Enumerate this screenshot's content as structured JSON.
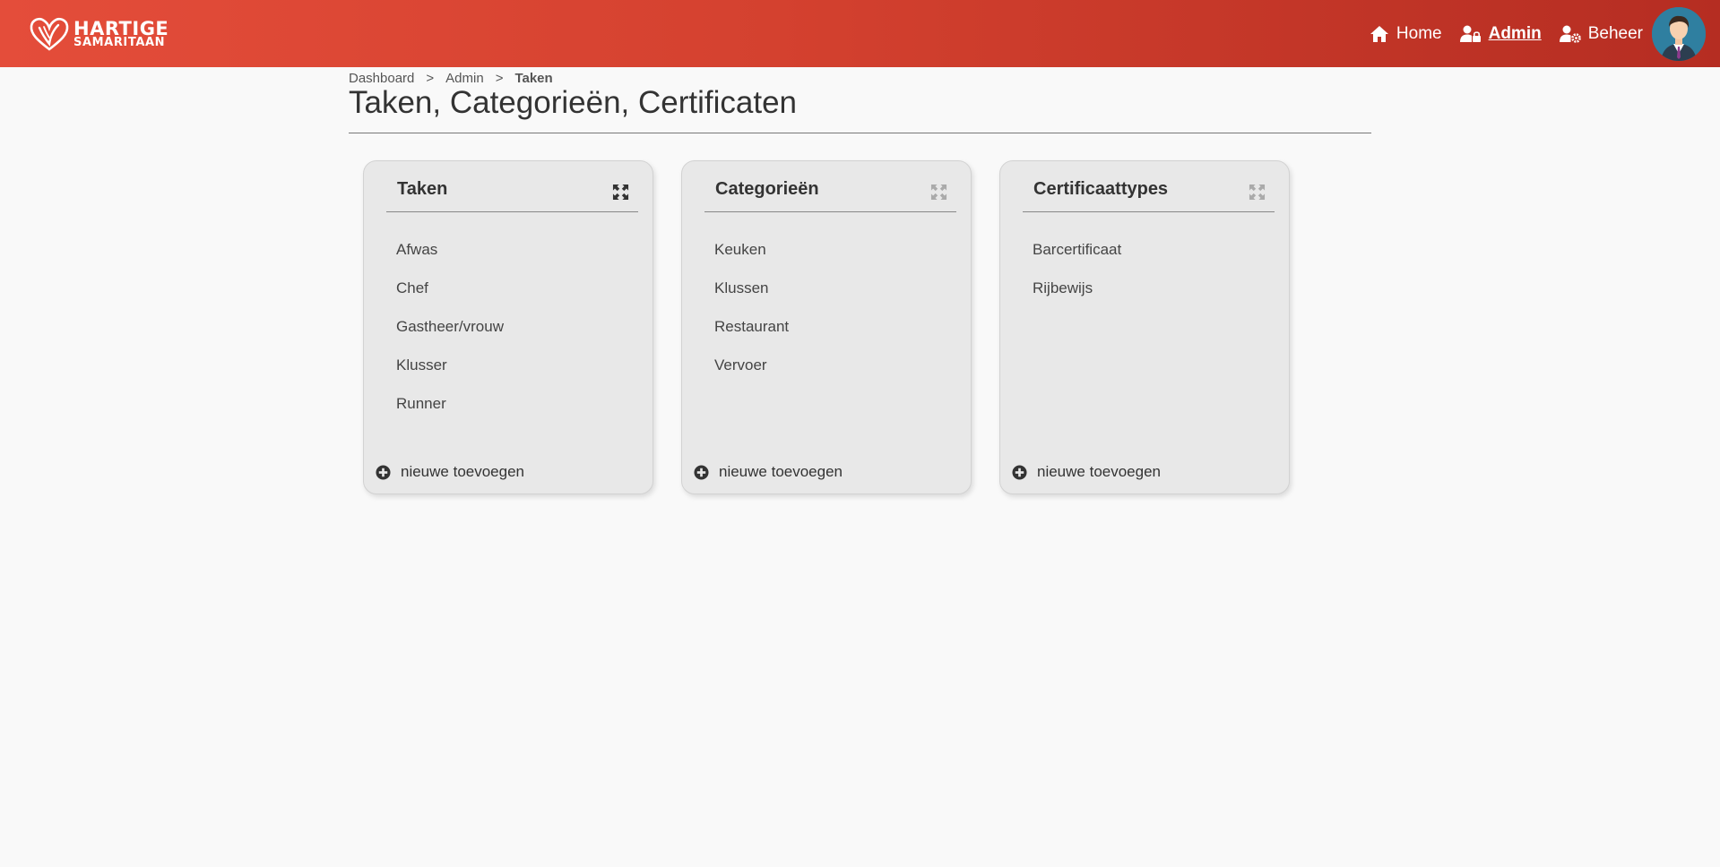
{
  "brand": {
    "logo_line1": "HARTIGE",
    "logo_line2": "SAMARITAAN"
  },
  "nav": {
    "items": [
      {
        "label": "Home",
        "icon": "home-icon"
      },
      {
        "label": "Admin",
        "icon": "user-lock-icon",
        "active": true
      },
      {
        "label": "Beheer",
        "icon": "user-gear-icon"
      }
    ]
  },
  "breadcrumb": {
    "items": [
      "Dashboard",
      "Admin",
      "Taken"
    ],
    "separator": ">"
  },
  "page": {
    "title": "Taken, Categorieën, Certificaten"
  },
  "cards": [
    {
      "title": "Taken",
      "items": [
        "Afwas",
        "Chef",
        "Gastheer/vrouw",
        "Klusser",
        "Runner"
      ],
      "add_label": "nieuwe toevoegen",
      "expand_active": true
    },
    {
      "title": "Categorieën",
      "items": [
        "Keuken",
        "Klussen",
        "Restaurant",
        "Vervoer"
      ],
      "add_label": "nieuwe toevoegen",
      "expand_active": false
    },
    {
      "title": "Certificaattypes",
      "items": [
        "Barcertificaat",
        "Rijbewijs"
      ],
      "add_label": "nieuwe toevoegen",
      "expand_active": false
    }
  ],
  "colors": {
    "header_start": "#e44d3a",
    "header_end": "#b52d22",
    "background": "#f9f9f9",
    "card_bg": "#e8e8e8"
  }
}
